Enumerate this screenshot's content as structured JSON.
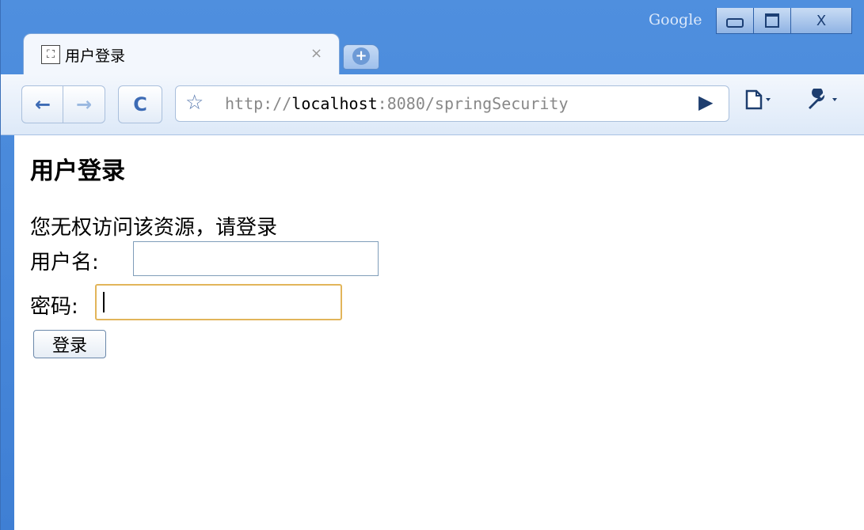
{
  "browser": {
    "brand": "Google",
    "tab": {
      "favicon": "page-icon",
      "title": "用户登录",
      "close": "×"
    },
    "new_tab": "+",
    "address": {
      "scheme": "http://",
      "host": "localhost",
      "rest": ":8080/springSecurity"
    },
    "icons": {
      "back": "←",
      "forward": "→",
      "reload": "C",
      "star": "☆",
      "go": "▶",
      "page_menu": "🗋▾",
      "wrench_menu": "🔧▾",
      "minimize": "minimize",
      "maximize": "maximize",
      "close": "X"
    }
  },
  "page": {
    "title": "用户登录",
    "notice": "您无权访问该资源，请登录",
    "username_label": "用户名:",
    "username_value": "",
    "password_label": "密码:",
    "password_value": "",
    "submit_label": "登录"
  }
}
